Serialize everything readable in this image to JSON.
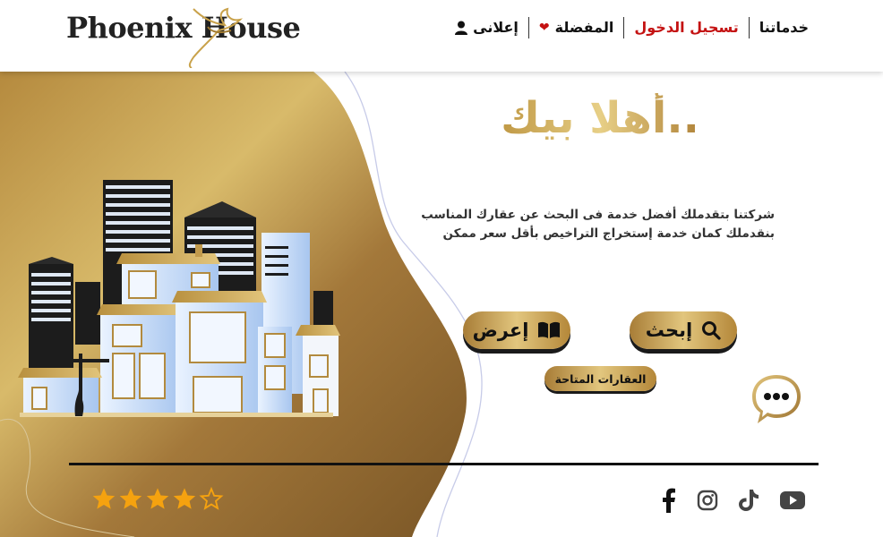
{
  "header": {
    "logo_text": "Phoenix House",
    "nav": [
      {
        "label": "خدماتنا",
        "icon": ""
      },
      {
        "label": "تسجيل الدخول",
        "icon": ""
      },
      {
        "label": "المفضلة",
        "icon": "heart-icon"
      },
      {
        "label": "إعلانى",
        "icon": "user-icon"
      }
    ]
  },
  "hero": {
    "welcome": "أهلا بيك..",
    "description_line1": "شركتنا بتقدملك أفضل خدمة فى البحث عن عقارك المناسب",
    "description_line2": "بنقدملك كمان خدمة إستخراج التراخيص بأقل سعر ممكن",
    "search_button": "إبحث",
    "show_button": "إعرض",
    "available_button": "العقارات المتاحة"
  },
  "footer": {
    "rating": 4,
    "rating_max": 5,
    "social": [
      "youtube-icon",
      "tiktok-icon",
      "instagram-icon",
      "facebook-icon"
    ]
  },
  "colors": {
    "gold_light": "#e7cf86",
    "gold_dark": "#8a6328",
    "star": "#f5a20f",
    "login_red": "#c41212"
  }
}
